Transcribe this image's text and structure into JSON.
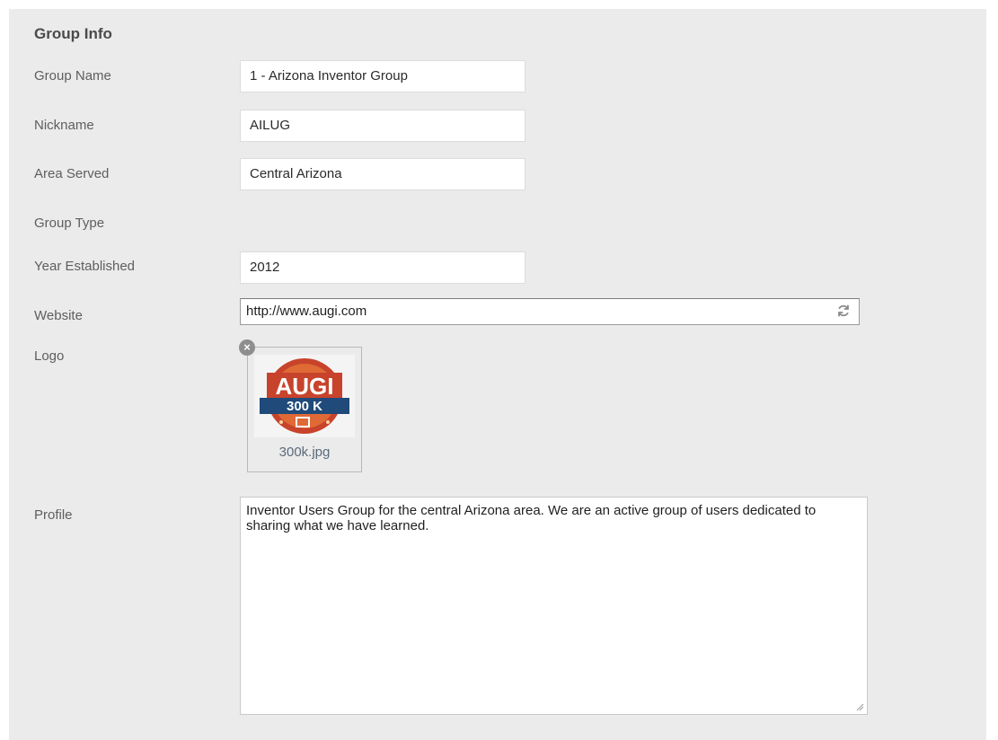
{
  "heading": "Group Info",
  "fields": {
    "group_name": {
      "label": "Group Name",
      "value": "1 - Arizona Inventor Group"
    },
    "nickname": {
      "label": "Nickname",
      "value": "AILUG"
    },
    "area_served": {
      "label": "Area Served",
      "value": "Central Arizona"
    },
    "group_type": {
      "label": "Group Type"
    },
    "year_established": {
      "label": "Year Established",
      "value": "2012"
    },
    "website": {
      "label": "Website",
      "value": "http://www.augi.com"
    },
    "logo": {
      "label": "Logo",
      "filename": "300k.jpg",
      "badge_top": "AUGI",
      "badge_bottom": "300 K"
    },
    "profile": {
      "label": "Profile",
      "value": "Inventor Users Group for the central Arizona area.  We are an active group of users dedicated to sharing what we have learned."
    }
  },
  "icons": {
    "remove": "close-icon",
    "refresh": "refresh-icon",
    "resize": "resize-grip-icon"
  }
}
